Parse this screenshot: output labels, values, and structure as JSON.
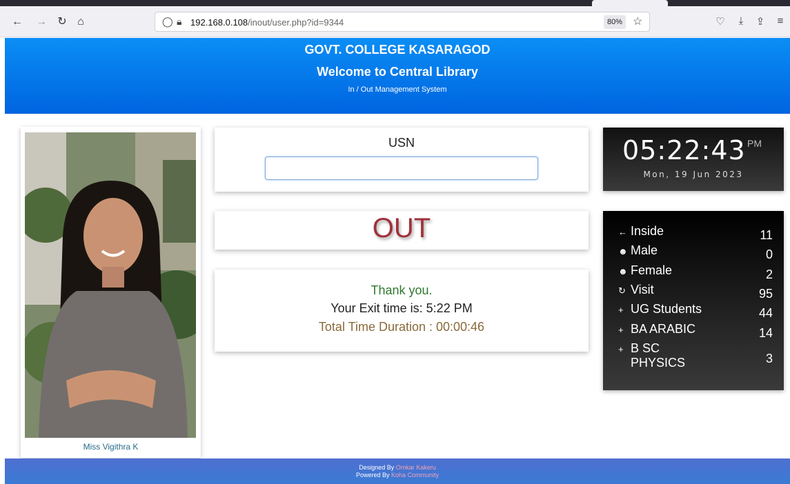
{
  "browser": {
    "url_host": "192.168.0.108",
    "url_path": "/inout/user.php?id=9344",
    "zoom": "80%"
  },
  "header": {
    "college": "GOVT. COLLEGE KASARAGOD",
    "welcome": "Welcome to Central Library",
    "subtitle": "In / Out Management System"
  },
  "photo": {
    "name": "Miss Vigithra K"
  },
  "usn": {
    "label": "USN",
    "value": ""
  },
  "status": {
    "text": "OUT"
  },
  "message": {
    "thanks": "Thank you.",
    "exit": "Your Exit time is: 5:22 PM",
    "duration": "Total Time Duration : 00:00:46"
  },
  "clock": {
    "time": "05:22:43",
    "ampm": "PM",
    "date": "Mon, 19 Jun 2023"
  },
  "stats": [
    {
      "icon": "arrow-left-icon",
      "label": "Inside",
      "value": "11"
    },
    {
      "icon": "male-icon",
      "label": "Male",
      "value": "0"
    },
    {
      "icon": "female-icon",
      "label": "Female",
      "value": "2"
    },
    {
      "icon": "refresh-icon",
      "label": "Visit",
      "value": "95"
    },
    {
      "icon": "plus-icon",
      "label": "UG Students",
      "value": "44"
    },
    {
      "icon": "plus-icon",
      "label": "BA ARABIC",
      "value": "14"
    },
    {
      "icon": "plus-icon",
      "label": "B SC PHYSICS",
      "value": "3"
    }
  ],
  "footer": {
    "designed_prefix": "Designed By",
    "designed_name": "Omkar Kakeru",
    "powered_prefix": "Powered By",
    "powered_name": "Koha Community"
  }
}
